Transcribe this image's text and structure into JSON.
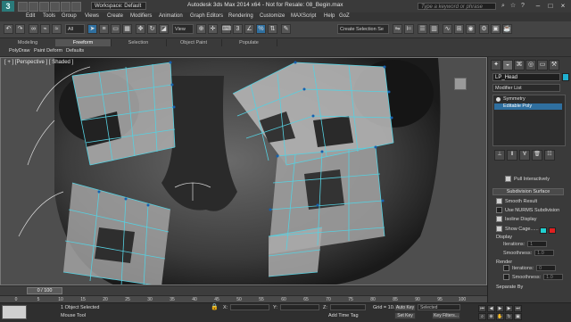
{
  "app": {
    "title": "Autodesk 3ds Max 2014 x64 - Not for Resale: 08_Begin.max",
    "workspace": "Workspace: Default",
    "search_placeholder": "Type a keyword or phrase"
  },
  "menu": [
    "Edit",
    "Tools",
    "Group",
    "Views",
    "Create",
    "Modifiers",
    "Animation",
    "Graph Editors",
    "Rendering",
    "Customize",
    "MAXScript",
    "Help",
    "GoZ"
  ],
  "toolbar": {
    "selection_filter": "All",
    "reference_coord": "View",
    "named_selection": "Create Selection Se"
  },
  "ribbon": {
    "tabs": [
      "Modeling",
      "Freeform",
      "Selection",
      "Object Paint",
      "Populate"
    ],
    "active_tab": "Freeform",
    "subtabs": [
      "PolyDraw",
      "Paint Deform",
      "Defaults"
    ]
  },
  "viewport": {
    "label": "[ + ] [Perspective ] [ Shaded ]",
    "mesh_color": "#56d0e0",
    "face_color": "#b9b9b9"
  },
  "command_panel": {
    "object_name": "LP_Head",
    "object_color": "#20b0d0",
    "modifier_list": "Modifier List",
    "stack": [
      "Symmetry",
      "Editable Poly"
    ],
    "selected_stack_item": "Editable Poly",
    "pull_interactively": "Pull Interactively",
    "subdivision_rollout": "Subdivision Surface",
    "smooth_result": "Smooth Result",
    "use_nurms": "Use NURMS Subdivision",
    "isoline_display": "Isoline Display",
    "show_cage": "Show Cage......",
    "display_label": "Display",
    "iterations_label": "Iterations:",
    "iterations_value": "1",
    "smoothness_label": "Smoothness:",
    "smoothness_value": "1.0",
    "render_label": "Render",
    "render_iterations_value": "0",
    "render_smoothness_value": "1.0",
    "separate_by": "Separate By",
    "cage_color_1": "#20d0d0",
    "cage_color_2": "#e02020"
  },
  "timeline": {
    "frame": "0 / 100",
    "ticks": [
      "0",
      "5",
      "10",
      "15",
      "20",
      "25",
      "30",
      "35",
      "40",
      "45",
      "50",
      "55",
      "60",
      "65",
      "70",
      "75",
      "80",
      "85",
      "90",
      "95",
      "100"
    ]
  },
  "status": {
    "selection": "1 Object Selected",
    "prompt": "Mouse Tool",
    "x_label": "X:",
    "y_label": "Y:",
    "z_label": "Z:",
    "grid": "Grid = 10.0",
    "add_time_tag": "Add Time Tag",
    "auto_key": "Auto Key",
    "set_key": "Set Key",
    "key_filter": "Selected",
    "key_filters_btn": "Key Filters..."
  }
}
